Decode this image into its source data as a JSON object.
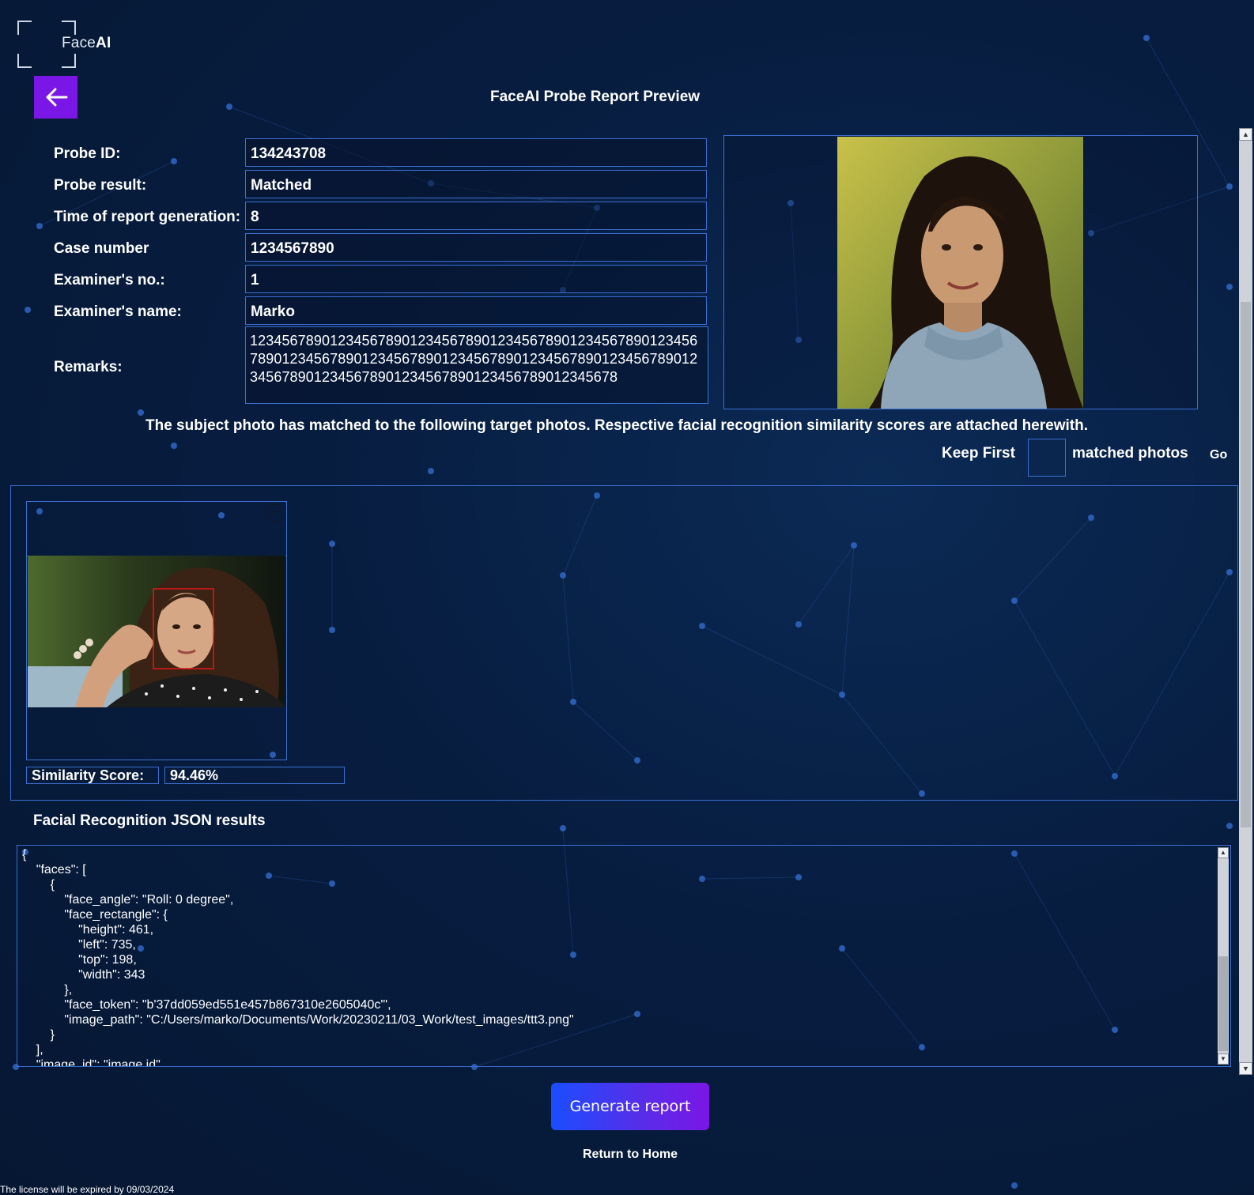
{
  "brand": {
    "name_light": "Face",
    "name_bold": "AI"
  },
  "header": {
    "title": "FaceAI Probe Report Preview"
  },
  "info": {
    "rows": [
      {
        "label": "Probe ID:",
        "value": "134243708"
      },
      {
        "label": "Probe result:",
        "value": "Matched"
      },
      {
        "label": "Time of report generation:",
        "value": "8"
      },
      {
        "label": "Case number",
        "value": "1234567890"
      },
      {
        "label": "Examiner's no.:",
        "value": "1"
      },
      {
        "label": "Examiner's name:",
        "value": "Marko"
      }
    ],
    "remarks_label": "Remarks:",
    "remarks_value": "12345678901234567890123456789012345678901234567890123456789012345678901234567890123456789012345678901234567890123456789012345678901234567890123456789012345678"
  },
  "match_text": "The subject photo has matched to the following target photos. Respective facial recognition similarity scores are attached herewith.",
  "keep": {
    "prefix": "Keep First",
    "value": "",
    "suffix": "matched photos",
    "go": "Go"
  },
  "result_card": {
    "similarity_label": "Similarity Score:",
    "similarity_value": "94.46%",
    "close_glyph": "×"
  },
  "json_section": {
    "title": "Facial Recognition JSON results",
    "content": "{\n    \"faces\": [\n        {\n            \"face_angle\": \"Roll: 0 degree\",\n            \"face_rectangle\": {\n                \"height\": 461,\n                \"left\": 735,\n                \"top\": 198,\n                \"width\": 343\n            },\n            \"face_token\": \"b'37dd059ed551e457b867310e2605040c'\",\n            \"image_path\": \"C:/Users/marko/Documents/Work/20230211/03_Work/test_images/ttt3.png\"\n        }\n    ],\n    \"image_id\": \"image id\""
  },
  "actions": {
    "generate": "Generate report",
    "return_home": "Return to Home"
  },
  "license_text": "The license will be expired by 09/03/2024",
  "colors": {
    "accent_purple": "#7a16e6",
    "border_blue": "#3b6fd1",
    "bg_dark": "#061733"
  },
  "icons": {
    "back": "arrow-left-icon",
    "close": "close-circle-icon"
  }
}
